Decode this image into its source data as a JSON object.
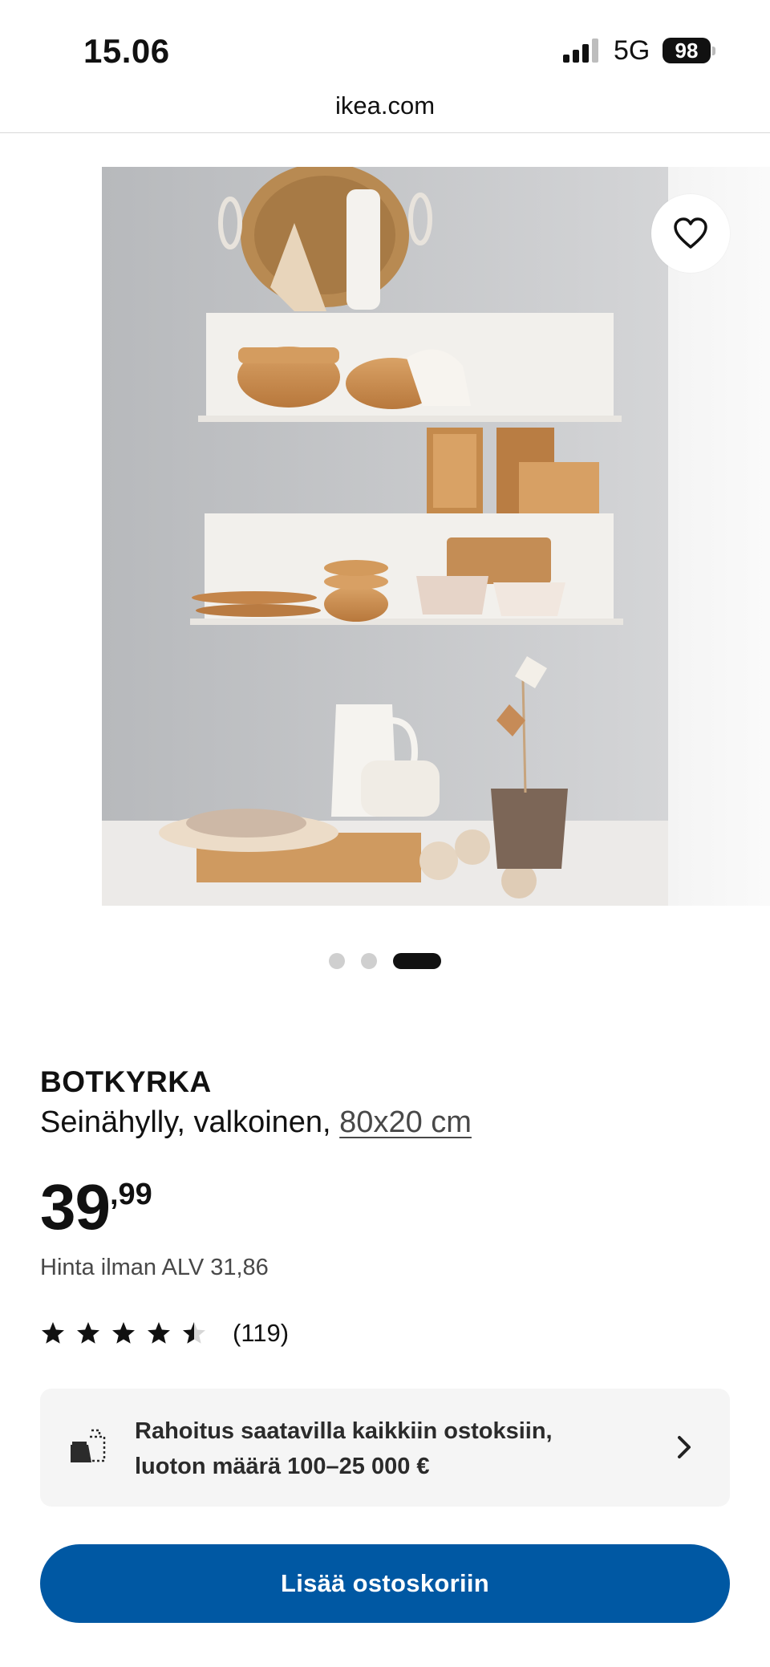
{
  "status_bar": {
    "time": "15.06",
    "network": "5G",
    "battery": "98"
  },
  "browser": {
    "url": "ikea.com"
  },
  "product": {
    "brand": "BOTKYRKA",
    "description": "Seinähylly, valkoinen, ",
    "size": "80x20 cm",
    "price_integer": "39",
    "price_decimal": ",99",
    "price_without_vat": "Hinta ilman ALV 31,86",
    "rating": 4.5,
    "rating_max": 5,
    "review_count": "(119)"
  },
  "gallery": {
    "dot_count": 3,
    "active_index": 2
  },
  "finance": {
    "line1": "Rahoitus saatavilla kaikkiin ostoksiin,",
    "line2": "luoton määrä 100–25 000 €"
  },
  "cta": {
    "label": "Lisää ostoskoriin",
    "color": "#0058a3"
  },
  "icons": {
    "favorite": "heart-outline-icon",
    "finance": "cash-register-icon",
    "chevron": "chevron-right-icon",
    "star": "star-icon"
  }
}
